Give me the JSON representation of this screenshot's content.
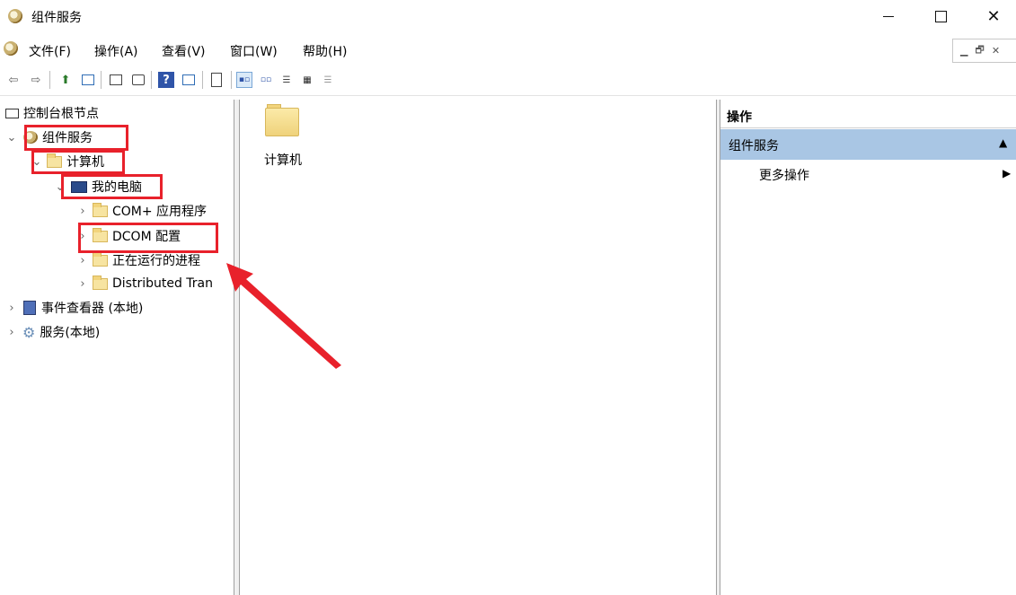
{
  "window": {
    "title": "组件服务"
  },
  "menu": [
    "文件(F)",
    "操作(A)",
    "查看(V)",
    "窗口(W)",
    "帮助(H)"
  ],
  "tree": {
    "root": "控制台根节点",
    "component_services": "组件服务",
    "computers": "计算机",
    "my_computer": "我的电脑",
    "com_plus": "COM+ 应用程序",
    "dcom": "DCOM 配置",
    "running": "正在运行的进程",
    "dtc": "Distributed Tran",
    "event_viewer": "事件查看器 (本地)",
    "services": "服务(本地)"
  },
  "content": {
    "item_label": "计算机"
  },
  "actions": {
    "title": "操作",
    "section": "组件服务",
    "more": "更多操作"
  },
  "colors": {
    "highlight": "#e8212b",
    "actions_section_bg": "#a9c6e4"
  }
}
